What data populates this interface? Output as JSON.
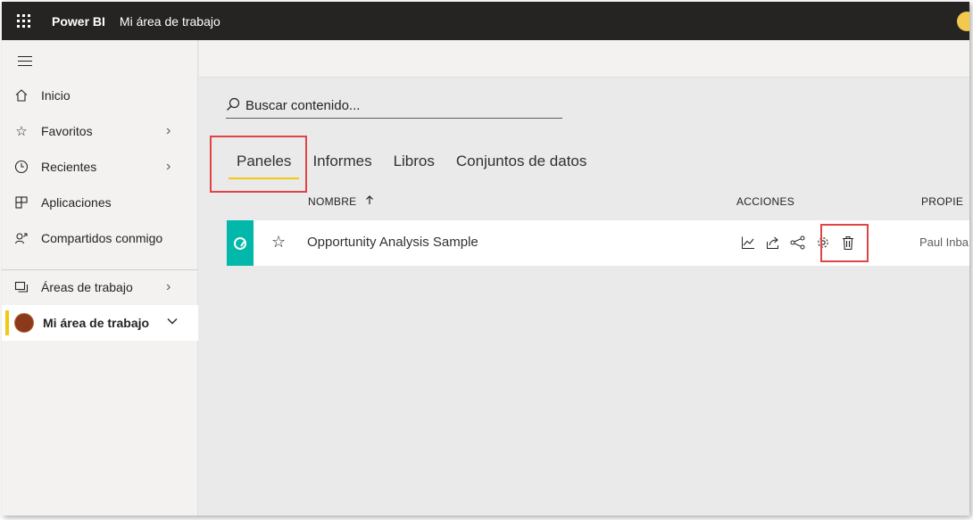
{
  "topbar": {
    "brand": "Power BI",
    "breadcrumb": "Mi área de trabajo"
  },
  "sidebar": {
    "items": [
      {
        "label": "Inicio",
        "icon": "home-icon"
      },
      {
        "label": "Favoritos",
        "icon": "star-icon"
      },
      {
        "label": "Recientes",
        "icon": "clock-icon"
      },
      {
        "label": "Aplicaciones",
        "icon": "apps-icon"
      },
      {
        "label": "Compartidos conmigo",
        "icon": "shared-icon"
      },
      {
        "label": "Áreas de trabajo",
        "icon": "workspaces-icon"
      },
      {
        "label": "Mi área de trabajo",
        "icon": "workspace-avatar"
      }
    ]
  },
  "search": {
    "placeholder": "Buscar contenido..."
  },
  "tabs": [
    "Paneles",
    "Informes",
    "Libros",
    "Conjuntos de datos"
  ],
  "table": {
    "headers": {
      "name": "NOMBRE",
      "actions": "ACCIONES",
      "owner": "PROPIE"
    },
    "rows": [
      {
        "name": "Opportunity Analysis Sample",
        "owner": "Paul Inba"
      }
    ]
  },
  "colors": {
    "accent": "#f2c811",
    "topbar": "#252423",
    "highlight": "#e04444",
    "thumb": "#01b8aa"
  }
}
